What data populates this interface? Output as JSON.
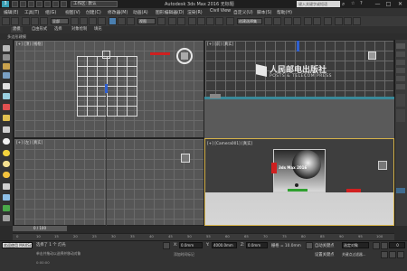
{
  "titlebar": {
    "workspace": "工作区: 默认",
    "title": "Autodesk 3ds Max 2016    无标题",
    "search_placeholder": "键入关键字或短语",
    "min": "—",
    "max": "□",
    "close": "✕"
  },
  "menu": [
    "编辑(E)",
    "工具(T)",
    "组(G)",
    "视图(V)",
    "创建(C)",
    "修改器(M)",
    "动画(A)",
    "图形编辑器(D)",
    "渲染(R)",
    "Civil View",
    "自定义(U)",
    "脚本(S)",
    "帮助(H)"
  ],
  "toolbar": {
    "selection_filter": "全部",
    "view_select": "视图",
    "named_select": "创建选择集"
  },
  "ribbon": {
    "tabs": [
      "建模",
      "自由形式",
      "选择",
      "对象绘制",
      "填充"
    ],
    "sub_label": "多边形建模"
  },
  "viewports": {
    "top_left": {
      "label": "[+] [顶] [线框]"
    },
    "top_right": {
      "label": "[+] [前] [真实]"
    },
    "bottom_left": {
      "label": "[+] [左] [真实]"
    },
    "bottom_right": {
      "label": "[+] [Camera001] [真实]"
    }
  },
  "logo_text": {
    "cn": "人民邮电出版社",
    "en": "POSTS & TELECOM PRESS"
  },
  "cover_text": "3ds Max 2016",
  "timeline": {
    "slider": "0 / 100",
    "ticks": [
      "0",
      "10",
      "15",
      "20",
      "25",
      "30",
      "35",
      "40",
      "45",
      "50",
      "55",
      "60",
      "65",
      "70",
      "75",
      "80",
      "85",
      "90",
      "95",
      "100"
    ]
  },
  "status": {
    "script_label": "欢迎使用 MAXSc",
    "selected": "选择了 1 个 灯光",
    "prompt": "单击并拖动以选择并移动对象",
    "x_label": "X:",
    "x_value": "0.0mm",
    "y_label": "Y:",
    "y_value": "4000.0mm",
    "z_label": "Z:",
    "z_value": "0.0mm",
    "grid": "栅格 = 10.0mm",
    "add_time_tag": "添加时间标记",
    "auto_key": "自动关键点",
    "set_key": "设置关键点",
    "selected_obj": "选定对象",
    "key_filters": "关键点过滤器...",
    "frame": "0",
    "time_display": "0:00:00"
  },
  "colors": {
    "accent": "#4a7fb0",
    "bg": "#2b2b2b",
    "viewport": "#565656",
    "gizmo_red": "#d02020",
    "gizmo_blue": "#3060d0",
    "gizmo_green": "#30c030"
  }
}
